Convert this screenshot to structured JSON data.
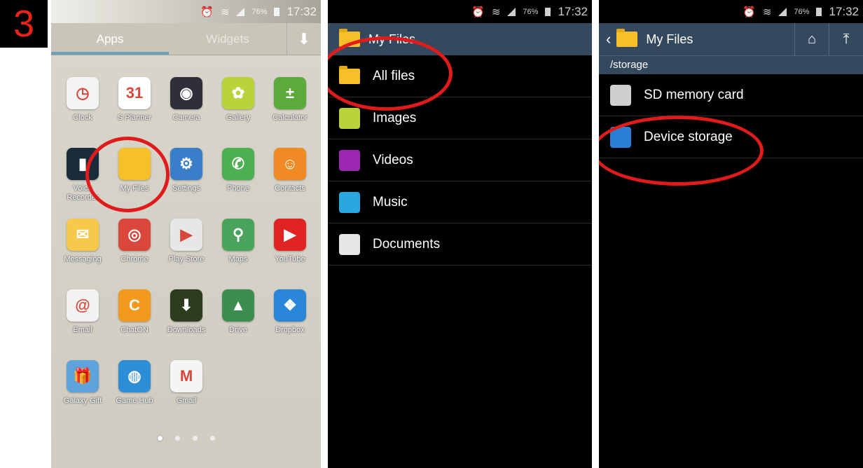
{
  "step_number": "3",
  "status": {
    "battery": "76%",
    "time": "17:32"
  },
  "panel1": {
    "tabs": {
      "apps": "Apps",
      "widgets": "Widgets"
    },
    "apps": [
      {
        "label": "Clock",
        "icon": "clock-icon",
        "color": "#f4f4f4",
        "glyph": "◷"
      },
      {
        "label": "S Planner",
        "icon": "calendar-icon",
        "color": "#ffffff",
        "glyph": "31"
      },
      {
        "label": "Camera",
        "icon": "camera-icon",
        "color": "#2f2f3a",
        "glyph": "◉"
      },
      {
        "label": "Gallery",
        "icon": "gallery-icon",
        "color": "#b9d33a",
        "glyph": "✿"
      },
      {
        "label": "Calculator",
        "icon": "calculator-icon",
        "color": "#5daa3c",
        "glyph": "±"
      },
      {
        "label": "Voice Recorder",
        "icon": "voice-recorder-icon",
        "color": "#1a2b3c",
        "glyph": "▮"
      },
      {
        "label": "My Files",
        "icon": "folder-icon",
        "color": "#f5c02a",
        "glyph": ""
      },
      {
        "label": "Settings",
        "icon": "gear-icon",
        "color": "#3a7dc8",
        "glyph": "⚙"
      },
      {
        "label": "Phone",
        "icon": "phone-icon",
        "color": "#4caf50",
        "glyph": "✆"
      },
      {
        "label": "Contacts",
        "icon": "contacts-icon",
        "color": "#f08a24",
        "glyph": "☺"
      },
      {
        "label": "Messaging",
        "icon": "messaging-icon",
        "color": "#f6c94b",
        "glyph": "✉"
      },
      {
        "label": "Chrome",
        "icon": "chrome-icon",
        "color": "#d9463b",
        "glyph": "◎"
      },
      {
        "label": "Play Store",
        "icon": "play-store-icon",
        "color": "#e7e7e7",
        "glyph": "▶"
      },
      {
        "label": "Maps",
        "icon": "maps-icon",
        "color": "#4aa35b",
        "glyph": "⚲"
      },
      {
        "label": "YouTube",
        "icon": "youtube-icon",
        "color": "#e02424",
        "glyph": "▶"
      },
      {
        "label": "Email",
        "icon": "email-icon",
        "color": "#f2f2f2",
        "glyph": "@"
      },
      {
        "label": "ChatON",
        "icon": "chaton-icon",
        "color": "#f39a1e",
        "glyph": "C"
      },
      {
        "label": "Downloads",
        "icon": "download-icon",
        "color": "#2d3b1e",
        "glyph": "⬇"
      },
      {
        "label": "Drive",
        "icon": "drive-icon",
        "color": "#3b8e4f",
        "glyph": "▲"
      },
      {
        "label": "Dropbox",
        "icon": "dropbox-icon",
        "color": "#2a86d9",
        "glyph": "❖"
      },
      {
        "label": "Galaxy Gift",
        "icon": "gift-icon",
        "color": "#5ea3dc",
        "glyph": "🎁"
      },
      {
        "label": "Game Hub",
        "icon": "gamepad-icon",
        "color": "#2c8fd6",
        "glyph": "◍"
      },
      {
        "label": "Gmail",
        "icon": "gmail-icon",
        "color": "#f5f5f5",
        "glyph": "M"
      }
    ]
  },
  "panel2": {
    "title": "My Files",
    "items": [
      {
        "label": "All files",
        "icon": "folder-icon",
        "color": "#f5c02a"
      },
      {
        "label": "Images",
        "icon": "images-icon",
        "color": "#b9d33a"
      },
      {
        "label": "Videos",
        "icon": "videos-icon",
        "color": "#9c27b0"
      },
      {
        "label": "Music",
        "icon": "music-icon",
        "color": "#29a8e0"
      },
      {
        "label": "Documents",
        "icon": "documents-icon",
        "color": "#e6e6e6"
      }
    ]
  },
  "panel3": {
    "title": "My Files",
    "path": "/storage",
    "items": [
      {
        "label": "SD memory card",
        "icon": "sd-card-icon",
        "color": "#cfcfcf"
      },
      {
        "label": "Device storage",
        "icon": "device-storage-icon",
        "color": "#2a7fd4"
      }
    ]
  },
  "highlight_color": "#e01b1b"
}
